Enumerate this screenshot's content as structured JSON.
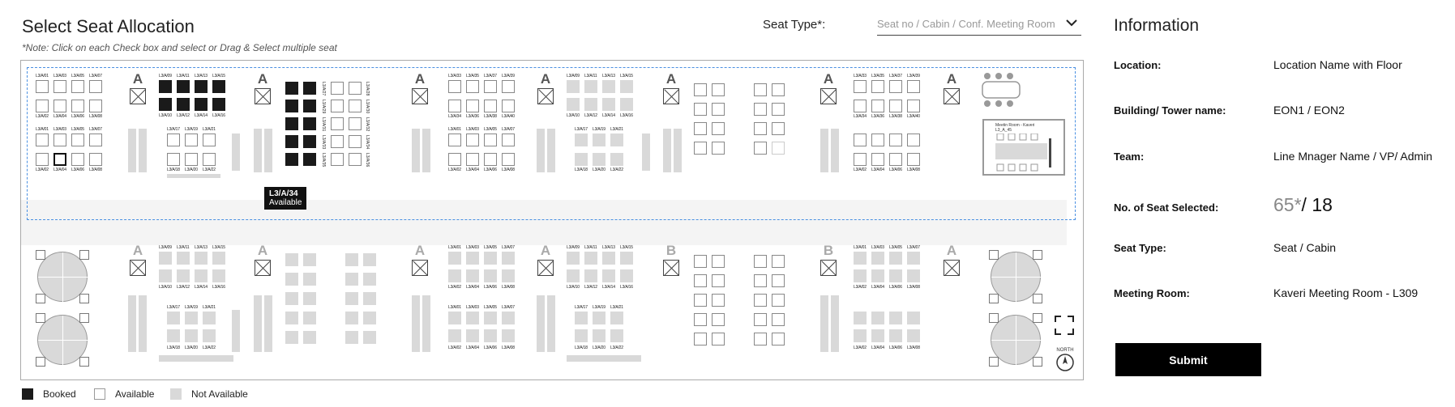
{
  "header": {
    "title": "Select Seat Allocation",
    "note": "*Note: Click on each Check box  and select or Drag & Select multiple seat",
    "seat_type_label": "Seat Type*:",
    "seat_type_placeholder": "Seat no /  Cabin  / Conf. Meeting Room"
  },
  "legend": {
    "booked": "Booked",
    "available": "Available",
    "not_available": "Not Available"
  },
  "tooltip": {
    "seat": "L3/A/34",
    "status": "Available"
  },
  "zones": {
    "top": [
      "A",
      "A",
      "A",
      "A",
      "A",
      "A",
      "A"
    ],
    "bottom": [
      "A",
      "A",
      "A",
      "A",
      "B",
      "B",
      "A"
    ]
  },
  "meeting_room": {
    "label_line1": "Meetin Room - Kaveri",
    "label_line2": "L3_A_45"
  },
  "compass": {
    "north": "NORTH"
  },
  "seat_labels": {
    "b1_top": [
      "L3/A/01",
      "L3/A/03",
      "L3/A/05",
      "L3/A/07"
    ],
    "b1_mid": [
      "L3/A/02",
      "L3/A/04",
      "L3/A/06",
      "L3/A/08"
    ],
    "b1_bot": [
      "L3/A/02",
      "L3/A/04",
      "L3/A/06",
      "L3/A/08"
    ],
    "b2_top": [
      "L3/A/09",
      "L3/A/11",
      "L3/A/13",
      "L3/A/15"
    ],
    "b2_mid": [
      "L3/A/10",
      "L3/A/12",
      "L3/A/14",
      "L3/A/16"
    ],
    "b2_low_top": [
      "L3/A/17",
      "L3/A/19",
      "L3/A/21"
    ],
    "b2_low_bot": [
      "L3/A/18",
      "L3/A/20",
      "L3/A/22"
    ],
    "b4_top": [
      "L3/A/33",
      "L3/A/35",
      "L3/A/37",
      "L3/A/39"
    ],
    "b4_mid": [
      "L3/A/34",
      "L3/A/36",
      "L3/A/38",
      "L3/A/40"
    ],
    "b4_bot": [
      "L3/A/02",
      "L3/A/04",
      "L3/A/06",
      "L3/A/08"
    ],
    "bot_b1_top": [
      "L3/A/09",
      "L3/A/11",
      "L3/A/13",
      "L3/A/15"
    ],
    "bot_b1_mid": [
      "L3/A/10",
      "L3/A/12",
      "L3/A/14",
      "L3/A/16"
    ],
    "bot_b1_low_top": [
      "L3/A/17",
      "L3/A/19",
      "L3/A/21"
    ],
    "bot_b1_low_bot": [
      "L3/A/18",
      "L3/A/20",
      "L3/A/22"
    ],
    "bot_b3_top": [
      "L3/A/01",
      "L3/A/03",
      "L3/A/05",
      "L3/A/07"
    ],
    "bot_b3_mid": [
      "L3/A/02",
      "L3/A/04",
      "L3/A/06",
      "L3/A/08"
    ],
    "vert_a": [
      "L3/A/27",
      "L3/A/29",
      "L3/A/31",
      "L3/A/33",
      "L3/A/35"
    ],
    "vert_b": [
      "L3/A/28",
      "L3/A/30",
      "L3/A/32",
      "L3/A/34",
      "L3/A/36"
    ]
  },
  "info": {
    "title": "Information",
    "location_label": "Location:",
    "location_value": "Location Name with Floor",
    "building_label": "Building/ Tower name:",
    "building_value": "EON1 / EON2",
    "team_label": "Team:",
    "team_value": "Line Mnager Name / VP/ Admin",
    "seats_label": "No. of Seat Selected:",
    "seats_count": "65*",
    "seats_total": "/ 18",
    "seat_type_label": "Seat Type:",
    "seat_type_value": "Seat / Cabin",
    "meeting_room_label": "Meeting Room:",
    "meeting_room_value": "Kaveri Meeting Room - L309",
    "submit": "Submit"
  }
}
